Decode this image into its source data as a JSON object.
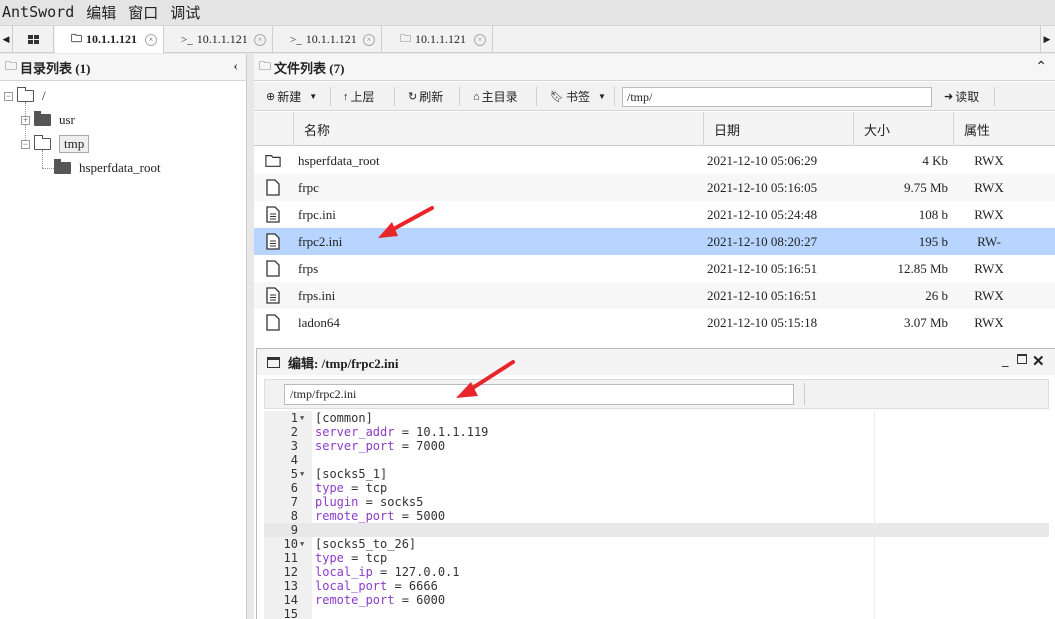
{
  "menubar": {
    "items": [
      "AntSword",
      "编辑",
      "窗口",
      "调试"
    ]
  },
  "tabs": [
    {
      "label": "10.1.1.121",
      "icon": "folder-icon",
      "active": true
    },
    {
      "label": "10.1.1.121",
      "icon": "terminal-icon",
      "active": false
    },
    {
      "label": "10.1.1.121",
      "icon": "terminal-icon",
      "active": false
    },
    {
      "label": "10.1.1.121",
      "icon": "folder-icon",
      "active": false
    }
  ],
  "dir_panel": {
    "title": "目录列表 (1)",
    "tree": [
      {
        "label": "/",
        "icon": "folder-open-icon"
      },
      {
        "label": "usr",
        "icon": "folder-closed-icon"
      },
      {
        "label": "tmp",
        "icon": "folder-open-icon",
        "selected": true
      },
      {
        "label": "hsperfdata_root",
        "icon": "folder-closed-icon"
      }
    ]
  },
  "file_panel": {
    "title": "文件列表 (7)",
    "toolbar": {
      "new_label": "新建",
      "up_label": "上层",
      "refresh_label": "刷新",
      "home_label": "主目录",
      "bookmark_label": "书签",
      "path_value": "/tmp/",
      "read_label": "读取"
    },
    "columns": [
      "名称",
      "日期",
      "大小",
      "属性"
    ],
    "files": [
      {
        "name": "hsperfdata_root",
        "date": "2021-12-10 05:06:29",
        "size": "4 Kb",
        "attr": "RWX",
        "icon": "folder-icon"
      },
      {
        "name": "frpc",
        "date": "2021-12-10 05:16:05",
        "size": "9.75 Mb",
        "attr": "RWX",
        "icon": "file-icon"
      },
      {
        "name": "frpc.ini",
        "date": "2021-12-10 05:24:48",
        "size": "108 b",
        "attr": "RWX",
        "icon": "text-file-icon"
      },
      {
        "name": "frpc2.ini",
        "date": "2021-12-10 08:20:27",
        "size": "195 b",
        "attr": "RW-",
        "icon": "text-file-icon",
        "selected": true
      },
      {
        "name": "frps",
        "date": "2021-12-10 05:16:51",
        "size": "12.85 Mb",
        "attr": "RWX",
        "icon": "file-icon"
      },
      {
        "name": "frps.ini",
        "date": "2021-12-10 05:16:51",
        "size": "26 b",
        "attr": "RWX",
        "icon": "text-file-icon"
      },
      {
        "name": "ladon64",
        "date": "2021-12-10 05:15:18",
        "size": "3.07 Mb",
        "attr": "RWX",
        "icon": "file-icon"
      }
    ]
  },
  "editor": {
    "title": "编辑: /tmp/frpc2.ini",
    "path_value": "/tmp/frpc2.ini",
    "active_line": 9,
    "lines": [
      {
        "n": "1",
        "fold": true,
        "section": "[common]"
      },
      {
        "n": "2",
        "key": "server_addr",
        "value": " = 10.1.1.119"
      },
      {
        "n": "3",
        "key": "server_port",
        "value": " = 7000"
      },
      {
        "n": "4"
      },
      {
        "n": "5",
        "fold": true,
        "section": "[socks5_1]"
      },
      {
        "n": "6",
        "key": "type",
        "value": " = tcp"
      },
      {
        "n": "7",
        "key": "plugin",
        "value": " = socks5"
      },
      {
        "n": "8",
        "key": "remote_port",
        "value": " = 5000"
      },
      {
        "n": "9"
      },
      {
        "n": "10",
        "fold": true,
        "section": "[socks5_to_26]"
      },
      {
        "n": "11",
        "key": "type",
        "value": " = tcp"
      },
      {
        "n": "12",
        "key": "local_ip",
        "value": " = 127.0.0.1"
      },
      {
        "n": "13",
        "key": "local_port",
        "value": " = 6666"
      },
      {
        "n": "14",
        "key": "remote_port",
        "value": " = 6000"
      },
      {
        "n": "15"
      }
    ]
  },
  "colors": {
    "selection": "#b7d5ff",
    "annotation_arrow": "#e8262a",
    "config_key": "#8b3cc9"
  }
}
